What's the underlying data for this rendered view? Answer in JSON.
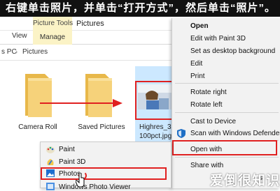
{
  "banner": {
    "text": "右键单击照片，并单击“打开方式”，然后单击“照片”。"
  },
  "window": {
    "context_title": "Picture Tools",
    "title": "Pictures"
  },
  "ribbon": {
    "tabs": [
      "View",
      "Manage"
    ]
  },
  "address": {
    "crumbs": [
      "s PC",
      "Pictures"
    ]
  },
  "files": [
    {
      "name": "Camera Roll",
      "type": "folder"
    },
    {
      "name": "Saved Pictures",
      "type": "folder"
    },
    {
      "name_line1": "Highres_30",
      "name_line2": "100pct.jpg",
      "type": "image"
    }
  ],
  "context_menu": {
    "items": [
      "Open",
      "Edit with Paint 3D",
      "Set as desktop background",
      "Edit",
      "Print",
      "Rotate right",
      "Rotate left",
      "Cast to Device",
      "Scan with Windows Defender",
      "Open with",
      "Share with",
      "s"
    ]
  },
  "open_with_menu": {
    "items": [
      "Paint",
      "Paint 3D",
      "Photos",
      "Windows Photo Viewer"
    ]
  },
  "watermark": {
    "text": "爱倒很知识网"
  },
  "colors": {
    "highlight": "#e02020",
    "selection": "#cce8ff",
    "context_tab": "#fbf3c6"
  }
}
